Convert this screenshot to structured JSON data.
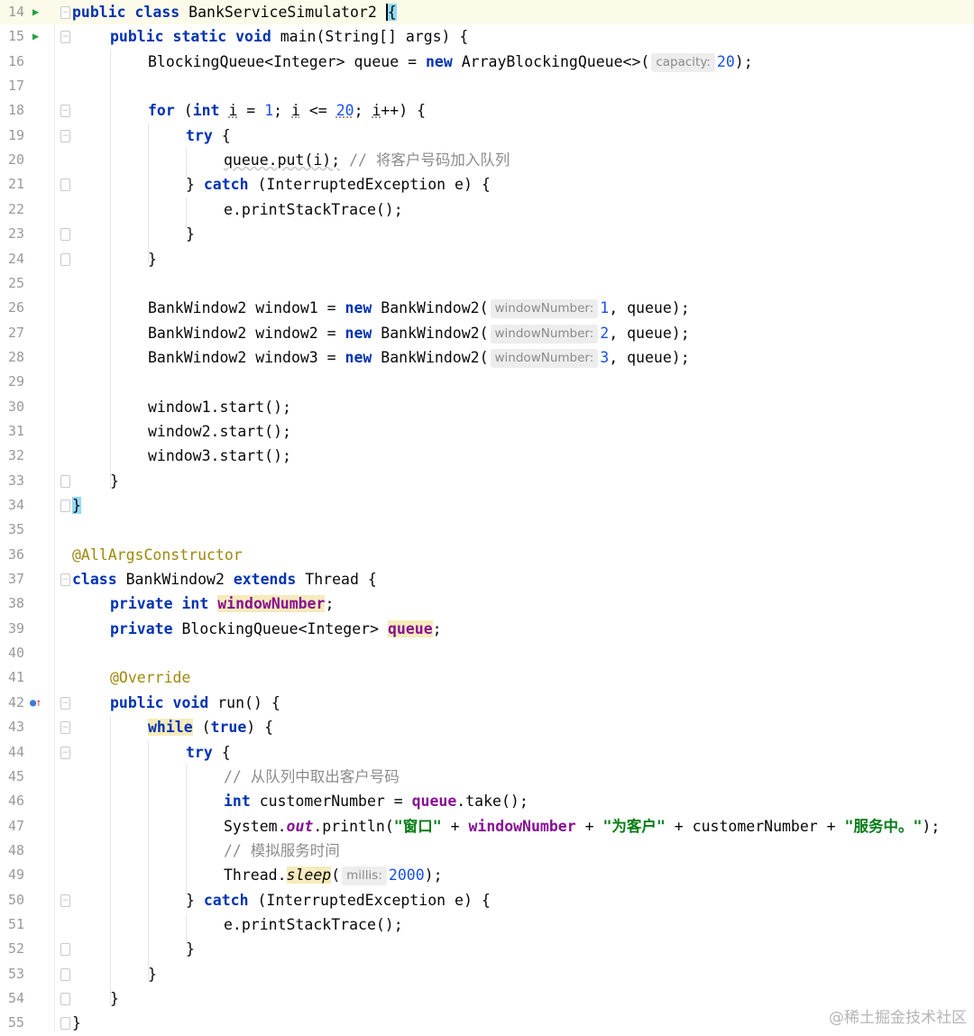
{
  "editor": {
    "lines": [
      {
        "n": "14",
        "run": true,
        "fold": "open"
      },
      {
        "n": "15",
        "run": true,
        "fold": "open"
      },
      {
        "n": "16"
      },
      {
        "n": "17"
      },
      {
        "n": "18",
        "fold": "open"
      },
      {
        "n": "19",
        "fold": "open"
      },
      {
        "n": "20"
      },
      {
        "n": "21",
        "fold": "close"
      },
      {
        "n": "22"
      },
      {
        "n": "23",
        "fold": "close"
      },
      {
        "n": "24",
        "fold": "close"
      },
      {
        "n": "25"
      },
      {
        "n": "26"
      },
      {
        "n": "27"
      },
      {
        "n": "28"
      },
      {
        "n": "29"
      },
      {
        "n": "30"
      },
      {
        "n": "31"
      },
      {
        "n": "32"
      },
      {
        "n": "33",
        "fold": "close"
      },
      {
        "n": "34",
        "fold": "close"
      },
      {
        "n": "35"
      },
      {
        "n": "36"
      },
      {
        "n": "37",
        "fold": "open"
      },
      {
        "n": "38"
      },
      {
        "n": "39"
      },
      {
        "n": "40"
      },
      {
        "n": "41"
      },
      {
        "n": "42",
        "override": true,
        "fold": "open"
      },
      {
        "n": "43",
        "fold": "open"
      },
      {
        "n": "44",
        "fold": "open"
      },
      {
        "n": "45"
      },
      {
        "n": "46"
      },
      {
        "n": "47"
      },
      {
        "n": "48"
      },
      {
        "n": "49"
      },
      {
        "n": "50",
        "fold": "open"
      },
      {
        "n": "51"
      },
      {
        "n": "52",
        "fold": "close"
      },
      {
        "n": "53",
        "fold": "close"
      },
      {
        "n": "54",
        "fold": "close"
      },
      {
        "n": "55",
        "fold": "close"
      }
    ],
    "code": {
      "l14": {
        "kw1": "public class",
        "name": "BankServiceSimulator2",
        "brace": "{"
      },
      "l15": {
        "kw1": "public static void",
        "rest": "main(String[] args) {"
      },
      "l16": {
        "pre": "BlockingQueue<Integer> queue = ",
        "kw": "new",
        "mid": "ArrayBlockingQueue<>(",
        "hint": "capacity:",
        "num": "20",
        "post": ");"
      },
      "l18": {
        "kw": "for",
        "p1": " (",
        "kw2": "int",
        "p2": " ",
        "i1": "i",
        "p3": " = ",
        "n1": "1",
        "p4": "; ",
        "i2": "i",
        "p5": " <= ",
        "n2": "20",
        "p6": "; ",
        "i3": "i",
        "p7": "++) {"
      },
      "l19": {
        "kw": "try",
        "post": " {"
      },
      "l20": {
        "code": "queue.put(i);",
        "cmt": "// 将客户号码加入队列"
      },
      "l21": {
        "pre": "} ",
        "kw": "catch",
        "post": " (InterruptedException e) {"
      },
      "l22": {
        "code": "e.printStackTrace();"
      },
      "l23": {
        "code": "}"
      },
      "l24": {
        "code": "}"
      },
      "l26": {
        "pre": "BankWindow2 window1 = ",
        "kw": "new",
        "mid": "BankWindow2(",
        "hint": "windowNumber:",
        "num": "1",
        "post": ", queue);"
      },
      "l27": {
        "pre": "BankWindow2 window2 = ",
        "kw": "new",
        "mid": "BankWindow2(",
        "hint": "windowNumber:",
        "num": "2",
        "post": ", queue);"
      },
      "l28": {
        "pre": "BankWindow2 window3 = ",
        "kw": "new",
        "mid": "BankWindow2(",
        "hint": "windowNumber:",
        "num": "3",
        "post": ", queue);"
      },
      "l30": {
        "code": "window1.start();"
      },
      "l31": {
        "code": "window2.start();"
      },
      "l32": {
        "code": "window3.start();"
      },
      "l33": {
        "code": "}"
      },
      "l34": {
        "code": "}"
      },
      "l36": {
        "ann": "@AllArgsConstructor"
      },
      "l37": {
        "kw": "class",
        "mid": " BankWindow2 ",
        "kw2": "extends",
        "post": " Thread {"
      },
      "l38": {
        "kw": "private int",
        "field": "windowNumber",
        "post": ";"
      },
      "l39": {
        "kw": "private",
        "mid": " BlockingQueue<Integer> ",
        "field": "queue",
        "post": ";"
      },
      "l41": {
        "ann": "@Override"
      },
      "l42": {
        "kw": "public void",
        "post": " run() {"
      },
      "l43": {
        "kw": "while",
        "p1": " (",
        "kw2": "true",
        "post": ") {"
      },
      "l44": {
        "kw": "try",
        "post": " {"
      },
      "l45": {
        "cmt": "// 从队列中取出客户号码"
      },
      "l46": {
        "kw": "int",
        "mid": " customerNumber = ",
        "field": "queue",
        "post": ".take();"
      },
      "l47": {
        "pre": "System.",
        "sfield": "out",
        "mid": ".println(",
        "s1": "\"窗口\"",
        "p1": " + ",
        "field": "windowNumber",
        "p2": " + ",
        "s2": "\"为客户\"",
        "p3": " + customerNumber + ",
        "s3": "\"服务中。\"",
        "post": ");"
      },
      "l48": {
        "cmt": "// 模拟服务时间"
      },
      "l49": {
        "pre": "Thread.",
        "smethod": "sleep",
        "mid": "(",
        "hint": "millis:",
        "num": "2000",
        "post": ");"
      },
      "l50": {
        "pre": "} ",
        "kw": "catch",
        "post": " (InterruptedException e) {"
      },
      "l51": {
        "code": "e.printStackTrace();"
      },
      "l52": {
        "code": "}"
      },
      "l53": {
        "code": "}"
      },
      "l54": {
        "code": "}"
      },
      "l55": {
        "code": "}"
      }
    }
  },
  "watermark": "@稀土掘金技术社区"
}
